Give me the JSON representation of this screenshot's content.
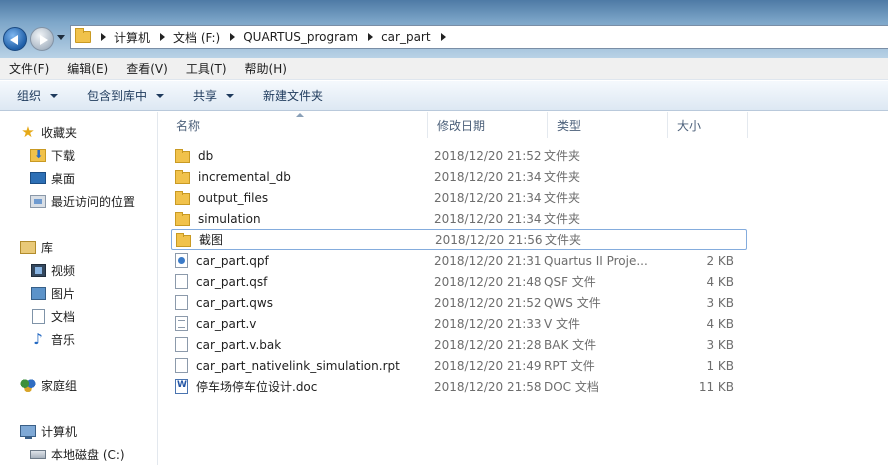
{
  "address": {
    "crumbs": [
      "计算机",
      "文档 (F:)",
      "QUARTUS_program",
      "car_part"
    ]
  },
  "menu": [
    "文件(F)",
    "编辑(E)",
    "查看(V)",
    "工具(T)",
    "帮助(H)"
  ],
  "toolbar": {
    "organize": "组织",
    "include_in_library": "包含到库中",
    "share": "共享",
    "new_folder": "新建文件夹"
  },
  "nav": {
    "favorites": "收藏夹",
    "downloads": "下载",
    "desktop": "桌面",
    "recent": "最近访问的位置",
    "libraries": "库",
    "videos": "视频",
    "pictures": "图片",
    "documents": "文档",
    "music": "音乐",
    "homegroup": "家庭组",
    "computer": "计算机",
    "local_disk": "本地磁盘 (C:)"
  },
  "columns": {
    "name": "名称",
    "date": "修改日期",
    "type": "类型",
    "size": "大小"
  },
  "files": [
    {
      "name": "db",
      "date": "2018/12/20 21:52",
      "type": "文件夹",
      "size": "",
      "icon": "folder-icon"
    },
    {
      "name": "incremental_db",
      "date": "2018/12/20 21:34",
      "type": "文件夹",
      "size": "",
      "icon": "folder-icon"
    },
    {
      "name": "output_files",
      "date": "2018/12/20 21:34",
      "type": "文件夹",
      "size": "",
      "icon": "folder-icon"
    },
    {
      "name": "simulation",
      "date": "2018/12/20 21:34",
      "type": "文件夹",
      "size": "",
      "icon": "folder-icon"
    },
    {
      "name": "截图",
      "date": "2018/12/20 21:56",
      "type": "文件夹",
      "size": "",
      "icon": "folder-icon"
    },
    {
      "name": "car_part.qpf",
      "date": "2018/12/20 21:31",
      "type": "Quartus II Proje...",
      "size": "2 KB",
      "icon": "quartus-project-icon"
    },
    {
      "name": "car_part.qsf",
      "date": "2018/12/20 21:48",
      "type": "QSF 文件",
      "size": "4 KB",
      "icon": "document-icon"
    },
    {
      "name": "car_part.qws",
      "date": "2018/12/20 21:52",
      "type": "QWS 文件",
      "size": "3 KB",
      "icon": "document-icon"
    },
    {
      "name": "car_part.v",
      "date": "2018/12/20 21:33",
      "type": "V 文件",
      "size": "4 KB",
      "icon": "text-file-icon"
    },
    {
      "name": "car_part.v.bak",
      "date": "2018/12/20 21:28",
      "type": "BAK 文件",
      "size": "3 KB",
      "icon": "document-icon"
    },
    {
      "name": "car_part_nativelink_simulation.rpt",
      "date": "2018/12/20 21:49",
      "type": "RPT 文件",
      "size": "1 KB",
      "icon": "document-icon"
    },
    {
      "name": "停车场停车位设计.doc",
      "date": "2018/12/20 21:58",
      "type": "DOC 文档",
      "size": "11 KB",
      "icon": "word-document-icon"
    }
  ]
}
